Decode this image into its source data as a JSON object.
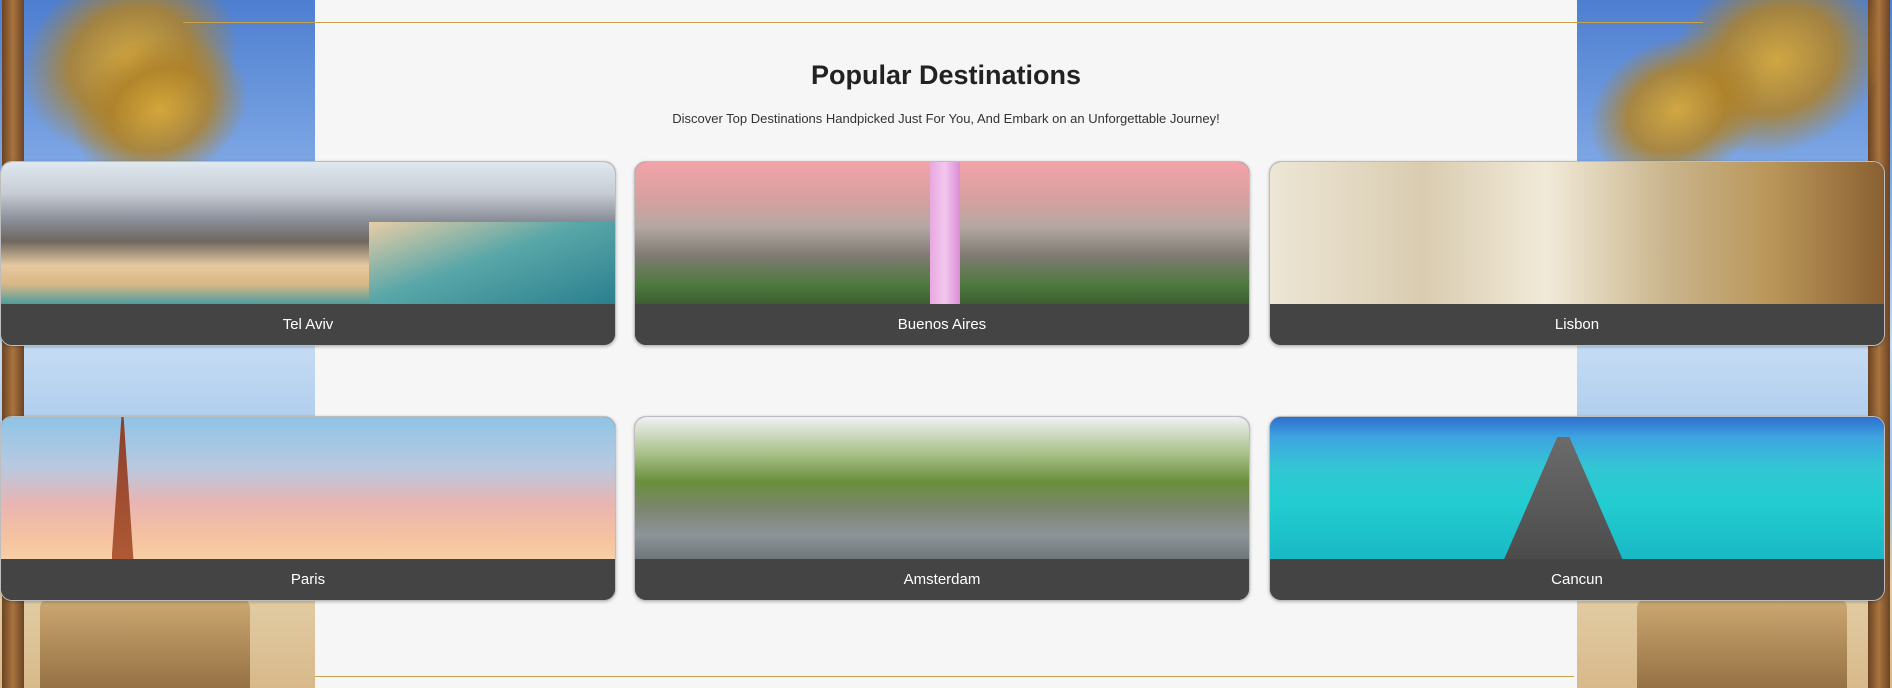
{
  "section": {
    "title": "Popular Destinations",
    "subtitle": "Discover Top Destinations Handpicked Just For You, And Embark on an Unforgettable Journey!"
  },
  "destinations": [
    {
      "name": "Tel Aviv",
      "image": "tel-aviv-beach-photo"
    },
    {
      "name": "Buenos Aires",
      "image": "buenos-aires-obelisk-photo"
    },
    {
      "name": "Lisbon",
      "image": "lisbon-tram-street-photo"
    },
    {
      "name": "Paris",
      "image": "paris-eiffel-tower-photo"
    },
    {
      "name": "Amsterdam",
      "image": "amsterdam-canal-photo"
    },
    {
      "name": "Cancun",
      "image": "cancun-pier-sea-photo"
    }
  ],
  "colors": {
    "accent_rule": "#c8a24a",
    "card_bar": "#444444",
    "page_bg": "#f6f6f6"
  }
}
